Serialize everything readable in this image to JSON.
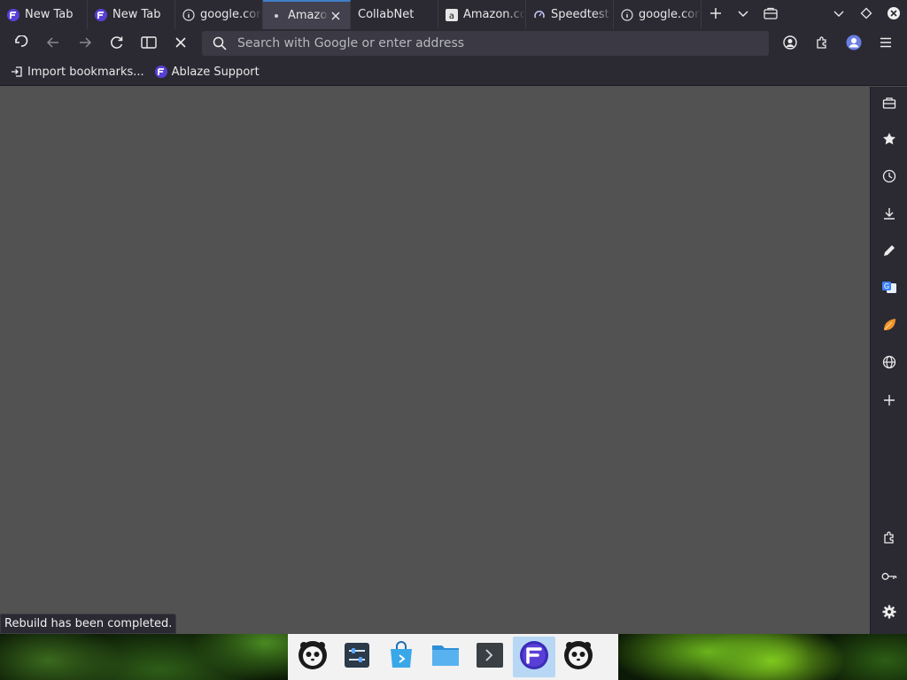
{
  "tabs": [
    {
      "title": "New Tab",
      "icon": "floorp-icon",
      "active": false
    },
    {
      "title": "New Tab",
      "icon": "floorp-icon",
      "active": false
    },
    {
      "title": "google.com",
      "icon": "info-icon",
      "active": false
    },
    {
      "title": "Amazon",
      "icon": "dot-icon",
      "active": true
    },
    {
      "title": "CollabNet",
      "icon": "none",
      "active": false
    },
    {
      "title": "Amazon.com",
      "icon": "amazon-icon",
      "active": false
    },
    {
      "title": "Speedtest",
      "icon": "speedtest-icon",
      "active": false
    },
    {
      "title": "google.com",
      "icon": "info-icon",
      "active": false
    }
  ],
  "urlbar": {
    "placeholder": "Search with Google or enter address",
    "value": ""
  },
  "bookmarks": [
    {
      "label": "Import bookmarks...",
      "icon": "import-icon"
    },
    {
      "label": "Ablaze Support",
      "icon": "floorp-icon"
    }
  ],
  "sidebar": {
    "items": [
      {
        "icon": "toolbox-icon"
      },
      {
        "icon": "star-icon"
      },
      {
        "icon": "history-icon"
      },
      {
        "icon": "download-icon"
      },
      {
        "icon": "pencil-icon"
      },
      {
        "icon": "translate-icon"
      },
      {
        "icon": "leaf-icon"
      },
      {
        "icon": "globe-icon"
      },
      {
        "icon": "plus-icon"
      },
      {
        "icon": "extension-icon"
      },
      {
        "icon": "key-icon"
      },
      {
        "icon": "gear-icon"
      }
    ]
  },
  "status": {
    "text": "Rebuild has been completed."
  },
  "dock": {
    "items": [
      {
        "icon": "panda-app-icon"
      },
      {
        "icon": "settings-app-icon"
      },
      {
        "icon": "store-app-icon"
      },
      {
        "icon": "files-app-icon"
      },
      {
        "icon": "terminal-app-icon"
      },
      {
        "icon": "floorp-app-icon",
        "active": true
      },
      {
        "icon": "panda-app-icon"
      }
    ]
  },
  "colors": {
    "chrome": "#2b2a33",
    "content": "#525252",
    "accent": "#3f7ec7",
    "floorp": "#5a3fd6"
  }
}
